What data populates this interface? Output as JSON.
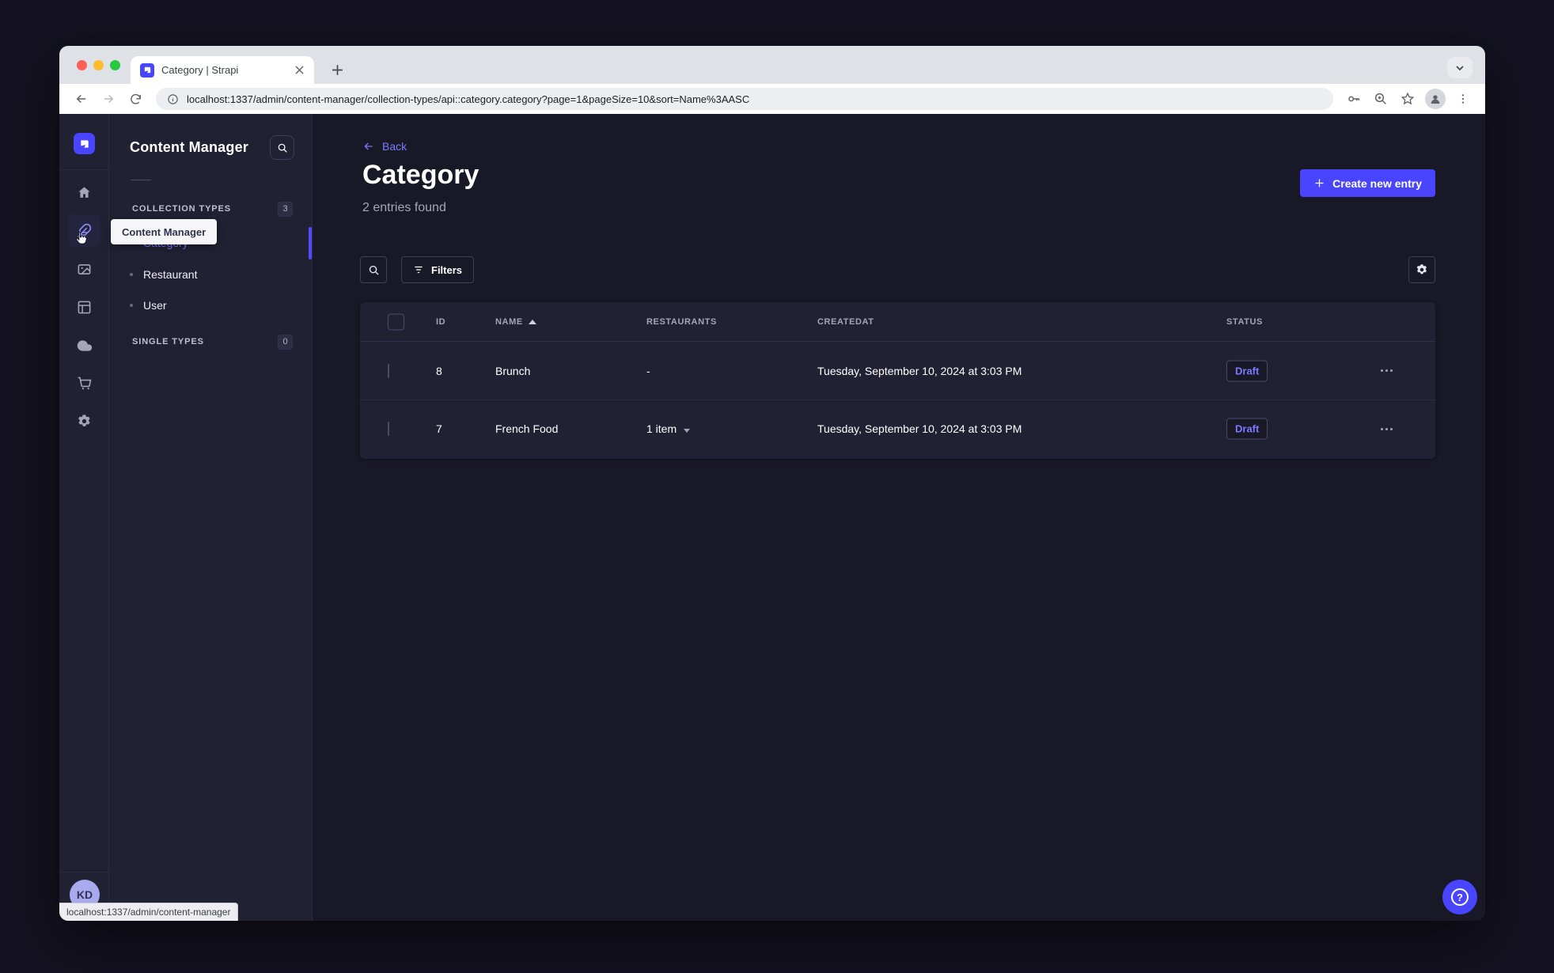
{
  "browser": {
    "tab_title": "Category | Strapi",
    "url": "localhost:1337/admin/content-manager/collection-types/api::category.category?page=1&pageSize=10&sort=Name%3AASC",
    "status_bar_text": "localhost:1337/admin/content-manager"
  },
  "main_nav": {
    "tooltip": "Content Manager",
    "user_initials": "KD"
  },
  "subnav": {
    "title": "Content Manager",
    "collection_types": {
      "label": "COLLECTION TYPES",
      "badge": "3",
      "items": [
        {
          "label": "Category",
          "active": true
        },
        {
          "label": "Restaurant",
          "active": false
        },
        {
          "label": "User",
          "active": false
        }
      ]
    },
    "single_types": {
      "label": "SINGLE TYPES",
      "badge": "0"
    }
  },
  "content": {
    "back_label": "Back",
    "title": "Category",
    "subtitle": "2 entries found",
    "create_button_label": "Create new entry",
    "filters_button_label": "Filters"
  },
  "table": {
    "columns": [
      "ID",
      "NAME",
      "RESTAURANTS",
      "CREATEDAT",
      "STATUS"
    ],
    "sorted_by": "NAME",
    "sort_direction": "ASC",
    "rows": [
      {
        "id": "8",
        "name": "Brunch",
        "restaurants": "-",
        "createdat": "Tuesday, September 10, 2024 at 3:03 PM",
        "status": "Draft"
      },
      {
        "id": "7",
        "name": "French Food",
        "restaurants": "1 item",
        "createdat": "Tuesday, September 10, 2024 at 3:03 PM",
        "status": "Draft"
      }
    ]
  },
  "colors": {
    "primary": "#4945ff",
    "primary_light": "#7b79ff",
    "app_background": "#181826",
    "surface": "#212134"
  }
}
